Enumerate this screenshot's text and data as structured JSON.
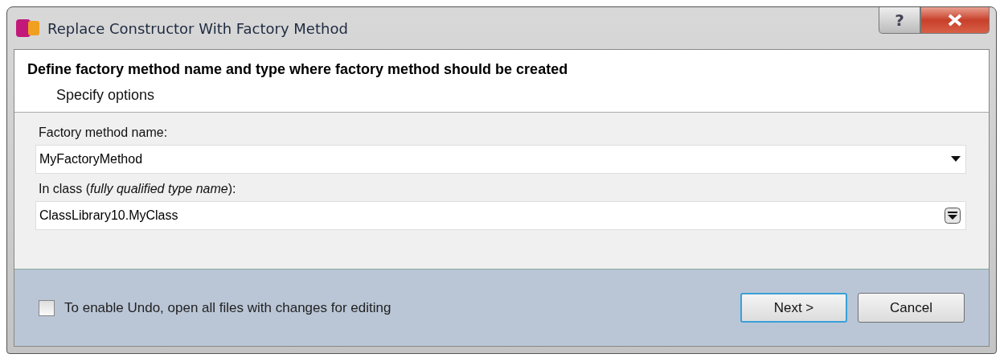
{
  "window": {
    "title": "Replace Constructor With Factory Method",
    "help_button": "?"
  },
  "header": {
    "title": "Define factory method name and type where factory method should be created",
    "subtitle": "Specify options"
  },
  "fields": [
    {
      "label": "Factory method name:",
      "value": "MyFactoryMethod",
      "kind": "dropdown"
    },
    {
      "label": "In class (*fully qualified type name*):",
      "value": "ClassLibrary10.MyClass",
      "kind": "picker"
    }
  ],
  "undo_option": {
    "label": "To enable Undo, open all files with changes for editing",
    "checked": false
  },
  "buttons": [
    {
      "label": "Next >",
      "default": true
    },
    {
      "label": "Cancel",
      "default": false
    }
  ]
}
